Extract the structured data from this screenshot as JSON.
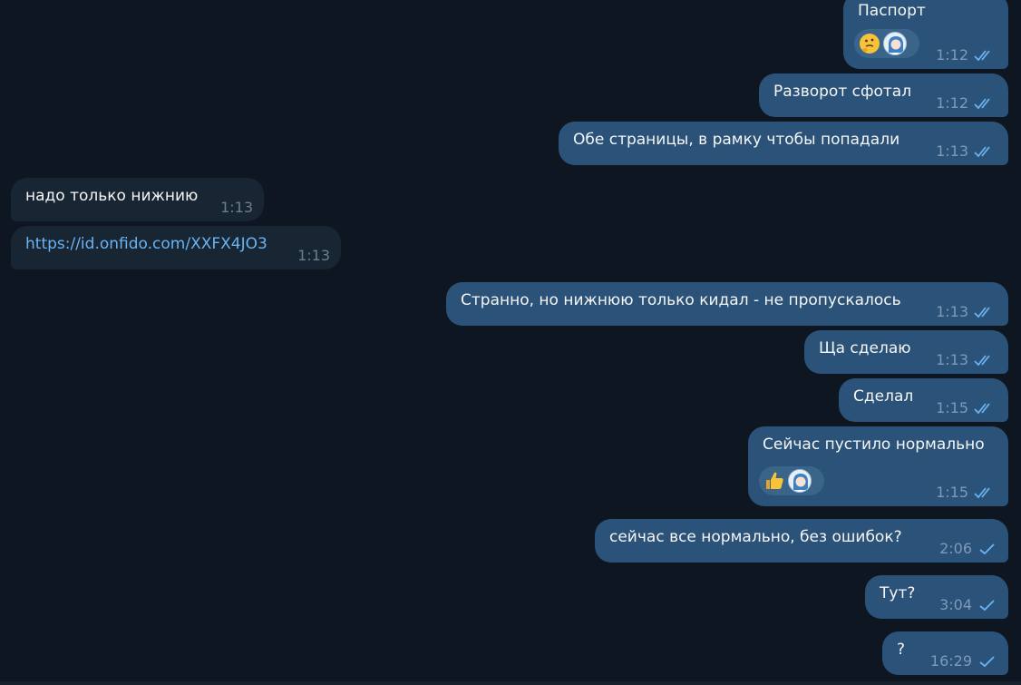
{
  "colors": {
    "background": "#0e1621",
    "bubble_out": "#2b5278",
    "bubble_in": "#182533",
    "link": "#6ab3f3",
    "check": "#6ab3f3"
  },
  "messages": [
    {
      "id": "m1",
      "dir": "out",
      "text": "Паспорт",
      "time": "1:12",
      "status": "read",
      "reactions": [
        "thinking-face-emoji",
        "user-avatar"
      ]
    },
    {
      "id": "m2",
      "dir": "out",
      "text": "Разворот сфотал",
      "time": "1:12",
      "status": "read"
    },
    {
      "id": "m3",
      "dir": "out",
      "text": "Обе страницы, в рамку чтобы попадали",
      "time": "1:13",
      "status": "read"
    },
    {
      "id": "m4",
      "dir": "in",
      "text": "надо только нижнию",
      "time": "1:13"
    },
    {
      "id": "m5",
      "dir": "in",
      "text": "https://id.onfido.com/XXFX4JO3",
      "time": "1:13",
      "is_link": true
    },
    {
      "id": "m6",
      "dir": "out",
      "text": "Странно, но нижнюю только кидал - не пропускалось",
      "time": "1:13",
      "status": "read"
    },
    {
      "id": "m7",
      "dir": "out",
      "text": "Ща сделаю",
      "time": "1:13",
      "status": "read"
    },
    {
      "id": "m8",
      "dir": "out",
      "text": "Сделал",
      "time": "1:15",
      "status": "read"
    },
    {
      "id": "m9",
      "dir": "out",
      "text": "Сейчас пустило нормально",
      "time": "1:15",
      "status": "read",
      "reactions": [
        "thumbs-up-emoji",
        "user-avatar"
      ]
    },
    {
      "id": "m10",
      "dir": "out",
      "text": "сейчас все нормально, без ошибок?",
      "time": "2:06",
      "status": "sent"
    },
    {
      "id": "m11",
      "dir": "out",
      "text": "Тут?",
      "time": "3:04",
      "status": "sent"
    },
    {
      "id": "m12",
      "dir": "out",
      "text": "?",
      "time": "16:29",
      "status": "sent"
    }
  ]
}
